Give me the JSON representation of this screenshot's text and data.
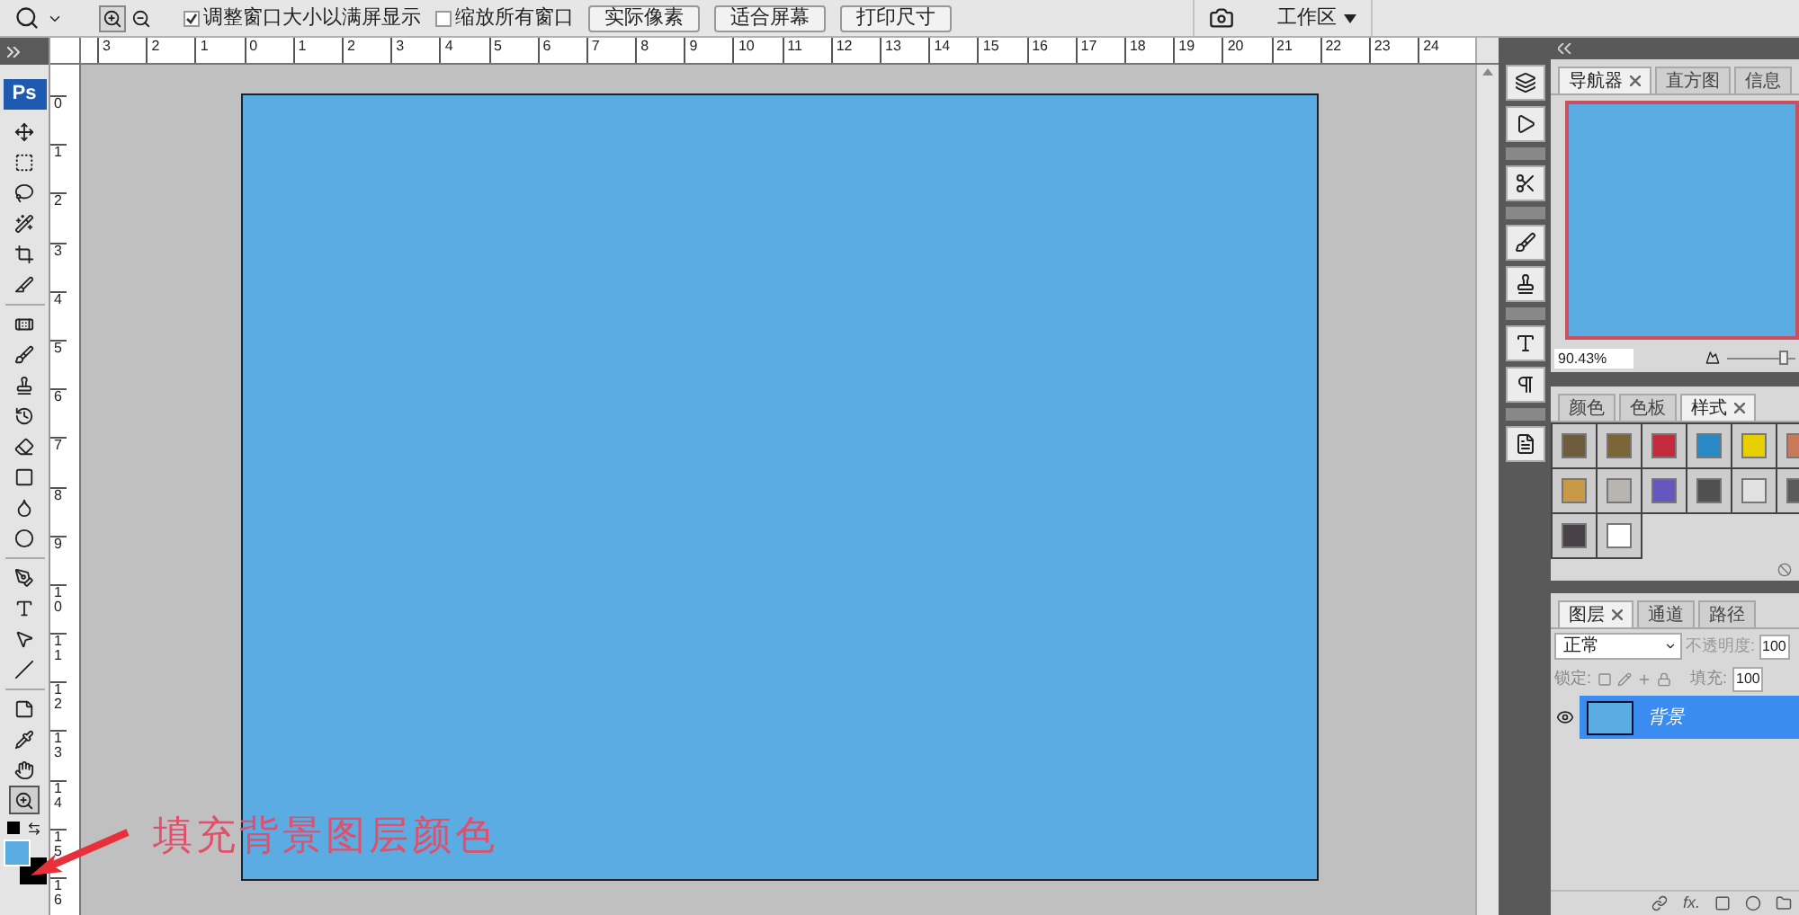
{
  "options_bar": {
    "zoom_modes": [
      {
        "kind": "zoom_in",
        "selected": true
      },
      {
        "kind": "zoom_out",
        "selected": false
      }
    ],
    "checkboxes": [
      {
        "label": "调整窗口大小以满屏显示",
        "checked": true
      },
      {
        "label": "缩放所有窗口",
        "checked": false
      }
    ],
    "buttons": [
      "实际像素",
      "适合屏幕",
      "打印尺寸"
    ],
    "workspace": "工作区"
  },
  "toolbox": {
    "logo": "Ps",
    "tools": [
      {
        "kind": "move",
        "selected": false
      },
      {
        "kind": "marquee",
        "selected": false
      },
      {
        "kind": "lasso",
        "selected": false
      },
      {
        "kind": "wand",
        "selected": false
      },
      {
        "kind": "crop",
        "selected": false
      },
      {
        "kind": "slice",
        "selected": false
      },
      {
        "kind": "heal",
        "selected": false
      },
      {
        "kind": "brush",
        "selected": false
      },
      {
        "kind": "stamp",
        "selected": false
      },
      {
        "kind": "history",
        "selected": false
      },
      {
        "kind": "eraser",
        "selected": false
      },
      {
        "kind": "gradient",
        "selected": false
      },
      {
        "kind": "blur",
        "selected": false
      },
      {
        "kind": "dodge",
        "selected": false
      },
      {
        "kind": "pen",
        "selected": false
      },
      {
        "kind": "type",
        "selected": false
      },
      {
        "kind": "pointer",
        "selected": false
      },
      {
        "kind": "line",
        "selected": false
      },
      {
        "kind": "note",
        "selected": false
      },
      {
        "kind": "eyedropper",
        "selected": false
      },
      {
        "kind": "hand",
        "selected": false
      },
      {
        "kind": "zoom",
        "selected": true
      }
    ],
    "foreground": {
      "color": "#5aace2"
    },
    "background": {
      "color": "#000000"
    }
  },
  "rulers": {
    "horizontal": [
      "3",
      "2",
      "1",
      "0",
      "1",
      "2",
      "3",
      "4",
      "5",
      "6",
      "7",
      "8",
      "9",
      "10",
      "11",
      "12",
      "13",
      "14",
      "15",
      "16",
      "17",
      "18",
      "19",
      "20",
      "21",
      "22",
      "23",
      "24"
    ],
    "vertical": [
      "0",
      "1",
      "2",
      "3",
      "4",
      "5",
      "6",
      "7",
      "8",
      "9",
      "10",
      "11",
      "12",
      "13",
      "14",
      "15",
      "16"
    ]
  },
  "document": {
    "color": "#5aace2"
  },
  "annotation": {
    "text": "填充背景图层颜色",
    "color": "#e0506a"
  },
  "navigator_panel": {
    "tabs": [
      {
        "label": "导航器",
        "selected": true,
        "closable": true
      },
      {
        "label": "直方图",
        "selected": false,
        "closable": false
      },
      {
        "label": "信息",
        "selected": false,
        "closable": false
      }
    ],
    "zoom": "90.43%",
    "level": 0.85
  },
  "styles_panel": {
    "tabs": [
      {
        "label": "颜色",
        "selected": false,
        "closable": false
      },
      {
        "label": "色板",
        "selected": false,
        "closable": false
      },
      {
        "label": "样式",
        "selected": true,
        "closable": true
      }
    ],
    "swatches": [
      {
        "color": "#6e5c3c"
      },
      {
        "color": "#7c6536"
      },
      {
        "color": "#c42a3e"
      },
      {
        "color": "#2a8ac8"
      },
      {
        "color": "#e6d000"
      },
      {
        "color": "#c87a58"
      },
      {
        "color": "#c89a48"
      },
      {
        "color": "#b8b4b0"
      },
      {
        "color": "#6656c0"
      },
      {
        "color": "#505050"
      },
      {
        "color": "#e2e2e2"
      },
      {
        "color": "#5a5a5a"
      },
      {
        "color": "#4a4048"
      },
      {
        "color": "#ffffff"
      }
    ]
  },
  "layers_panel": {
    "tabs": [
      {
        "label": "图层",
        "selected": true,
        "closable": true
      },
      {
        "label": "通道",
        "selected": false,
        "closable": false
      },
      {
        "label": "路径",
        "selected": false,
        "closable": false
      }
    ],
    "blend_mode": "正常",
    "opacity_label": "不透明度:",
    "opacity": "100",
    "lock_label": "锁定:",
    "fill_label": "填充:",
    "fill": "100",
    "effects_label": "fx.",
    "layers": [
      {
        "name": "背景",
        "selected": true,
        "visible": true,
        "color": "#5aace2"
      }
    ]
  }
}
